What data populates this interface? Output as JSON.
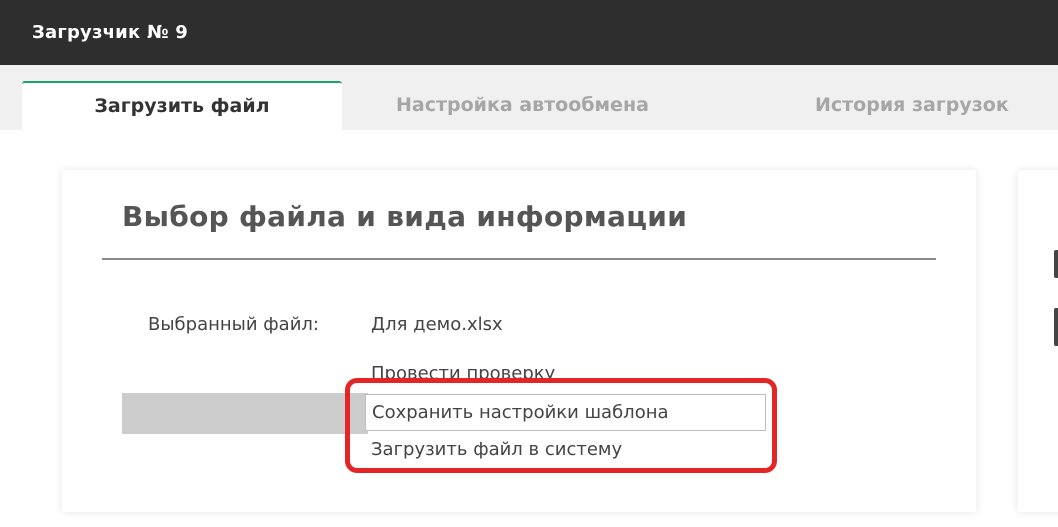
{
  "header": {
    "title": "Загрузчик № 9"
  },
  "tabs": [
    {
      "label": "Загрузить файл",
      "active": true
    },
    {
      "label": "Настройка автообмена",
      "active": false
    },
    {
      "label": "История загрузок",
      "active": false
    }
  ],
  "card": {
    "title": "Выбор файла и вида информации",
    "selected_file_label": "Выбранный файл:",
    "selected_file_name": "Для демо.xlsx",
    "menu": [
      {
        "label": "Провести проверку"
      },
      {
        "label": "Сохранить настройки шаблона"
      },
      {
        "label": "Загрузить файл в систему"
      }
    ]
  },
  "colors": {
    "topbar": "#2e2e2e",
    "active_tab_accent": "#1aa36a",
    "highlight": "#e32525"
  }
}
